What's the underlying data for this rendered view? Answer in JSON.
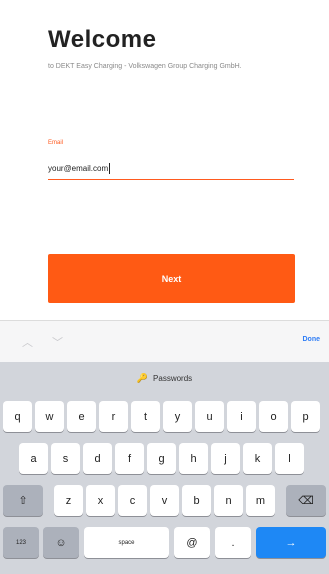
{
  "header": {
    "title": "Welcome",
    "subtitle": "to DEKT Easy Charging - Volkswagen Group Charging GmbH."
  },
  "form": {
    "email_label": "Email",
    "email_value": "your@email.com",
    "next_label": "Next"
  },
  "accessory": {
    "done_label": "Done",
    "prev_icon": "chevron-up-icon",
    "next_icon": "chevron-down-icon"
  },
  "keyboard": {
    "suggestion": "Passwords",
    "row1": [
      "q",
      "w",
      "e",
      "r",
      "t",
      "y",
      "u",
      "i",
      "o",
      "p"
    ],
    "row2": [
      "a",
      "s",
      "d",
      "f",
      "g",
      "h",
      "j",
      "k",
      "l"
    ],
    "row3": [
      "z",
      "x",
      "c",
      "v",
      "b",
      "n",
      "m"
    ],
    "numbers_label": "123",
    "space_label": "space",
    "at_label": "@",
    "dot_label": ".",
    "shift_icon": "shift-icon",
    "delete_icon": "delete-icon",
    "emoji_icon": "emoji-icon",
    "return_icon": "return-icon"
  },
  "colors": {
    "accent": "#ff5a14",
    "done": "#2f7df6",
    "keyboard_bg": "#d2d5db",
    "return_key": "#1e88f5"
  }
}
